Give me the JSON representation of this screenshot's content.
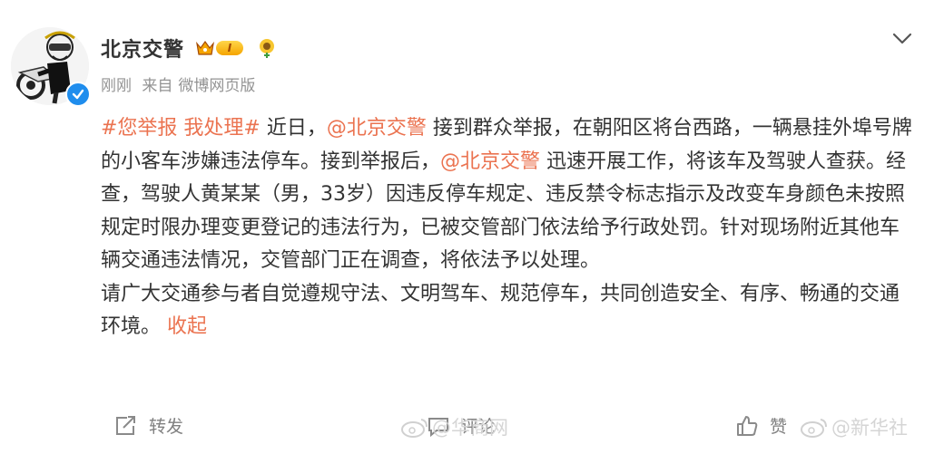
{
  "author": {
    "name": "北京交警",
    "vip_level": "I",
    "verified": true
  },
  "meta": {
    "time": "刚刚",
    "source_prefix": "来自",
    "source": "微博网页版"
  },
  "post": {
    "line1": {
      "tag": "#您举报 我处理#",
      "t1": " 近日，",
      "mention1": "@北京交警",
      "t2": " 接到群众举报，在朝阳区将台西路，一辆悬挂外埠号牌的小客车涉嫌违法停车。接到举报后，",
      "mention2": "@北京交警",
      "t3": " 迅速开展工作，将该车及驾驶人查获。经查，驾驶人黄某某（男，33岁）因违反停车规定、违反禁令标志指示及改变车身颜色未按照规定时限办理变更登记的违法行为，已被交管部门依法给予行政处罚。针对现场附近其他车辆交通违法情况，交管部门正在调查，将依法予以处理。"
    },
    "line2": "请广大交通参与者自觉遵规守法、文明驾车、规范停车，共同创造安全、有序、畅通的交通环境。",
    "collapse": "收起"
  },
  "actions": {
    "repost": "转发",
    "comment": "评论",
    "like": "赞"
  },
  "watermarks": {
    "left": "@华商网",
    "right": "@新华社"
  },
  "colors": {
    "link": "#eb7350",
    "text": "#333333",
    "meta": "#939393",
    "verify": "#1f8ded"
  }
}
